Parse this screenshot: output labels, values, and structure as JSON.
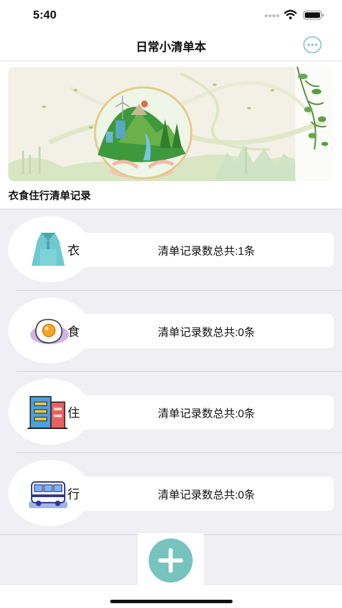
{
  "status_bar": {
    "time": "5:40"
  },
  "nav": {
    "title": "日常小清单本",
    "more_icon": "ellipsis-circle-icon"
  },
  "banner": {
    "caption": "衣食住行清单记录"
  },
  "categories": [
    {
      "label": "衣",
      "count_text": "清单记录数总共:1条",
      "icon": "jacket-icon"
    },
    {
      "label": "食",
      "count_text": "清单记录数总共:0条",
      "icon": "fried-egg-icon"
    },
    {
      "label": "住",
      "count_text": "清单记录数总共:0条",
      "icon": "building-icon"
    },
    {
      "label": "行",
      "count_text": "清单记录数总共:0条",
      "icon": "bus-icon"
    }
  ],
  "colors": {
    "accent": "#76c4bd",
    "background": "#efeff4"
  }
}
